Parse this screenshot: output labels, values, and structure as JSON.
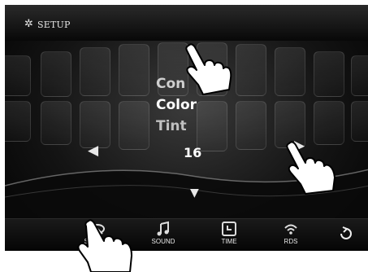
{
  "header": {
    "icon": "gear-icon",
    "title": "SETUP"
  },
  "menu": {
    "items": [
      "Con",
      "Color",
      "Tint"
    ],
    "value": "16"
  },
  "tabs": [
    {
      "label": "SYSTEM",
      "icon": "system-icon"
    },
    {
      "label": "SOUND",
      "icon": "music-note-icon"
    },
    {
      "label": "TIME",
      "icon": "clock-icon"
    },
    {
      "label": "RDS",
      "icon": "radio-signal-icon"
    }
  ],
  "back_icon": "back-arrow-icon",
  "colors": {
    "background": "#000000",
    "text": "#ffffff",
    "tile": "#2a2a2a"
  }
}
